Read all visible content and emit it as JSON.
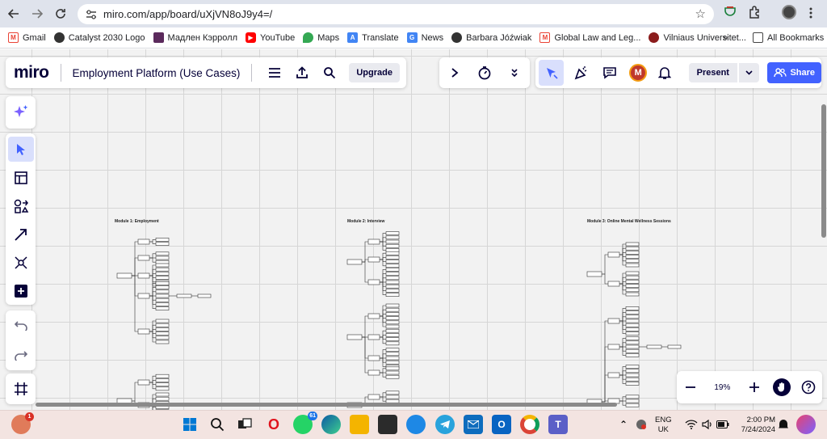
{
  "browser": {
    "url": "miro.com/app/board/uXjVN8oJ9y4=/",
    "bookmarks": [
      "Gmail",
      "Catalyst 2030 Logo",
      "Мадлен Кэрролл",
      "YouTube",
      "Maps",
      "Translate",
      "News",
      "Barbara Jóźwiak",
      "Global Law and Leg...",
      "Vilniaus Universitet...",
      "All Bookmarks"
    ],
    "more_label": "»"
  },
  "miro": {
    "logo": "miro",
    "board_title": "Employment Platform (Use Cases)",
    "upgrade_label": "Upgrade",
    "present_label": "Present",
    "share_label": "Share",
    "avatar_initial": "M",
    "zoom": "19%",
    "accent_color": "#4262ff",
    "modules": [
      {
        "title": "Module 1: Employment"
      },
      {
        "title": "Module 2: Interview"
      },
      {
        "title": "Module 3: Online Mental Wellness Sessions"
      }
    ]
  },
  "taskbar": {
    "lang_1": "ENG",
    "lang_2": "UK",
    "time": "2:00 PM",
    "date": "7/24/2024",
    "whatsapp_badge": "61",
    "notif_badge": "1"
  }
}
